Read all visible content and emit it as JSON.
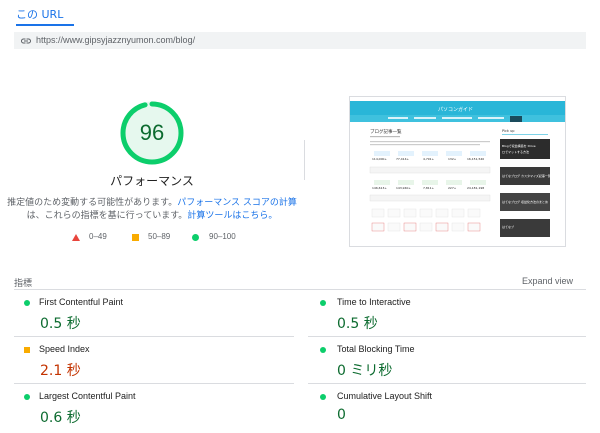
{
  "tab": {
    "label": "この URL"
  },
  "url": {
    "text": "https://www.gipsyjazznyumon.com/blog/"
  },
  "score": {
    "value": "96",
    "title": "パフォーマンス",
    "desc_part1": "推定値のため変動する可能性があります。",
    "desc_link1": "パフォーマンス スコアの計算",
    "desc_part2": "は、これらの指標を基に行っています。",
    "desc_link2": "計算ツールはこちら。",
    "fraction": 0.96,
    "color": "#0cce6b"
  },
  "legend": {
    "fail": "0–49",
    "average": "50–89",
    "pass": "90–100"
  },
  "thumbnail": {
    "site_title": "パソコンガイド",
    "page_heading": "ブログ記事一覧",
    "sidebar_heading": "Pick up",
    "side_items": [
      "Blogで収益構造を Drive",
      "ロでマットする方法",
      "はてなブログ カスタマイズ記事一覧",
      "はてなブログ 収益化方法のまとめ",
      "はてなブ"
    ],
    "stats_row1": [
      "114,000+",
      "77,414+",
      "4,791+",
      "132+",
      "16,151,540"
    ],
    "stats_row2": [
      "146,613+",
      "143,940+",
      "7,811+",
      "227+",
      "24,181,198"
    ]
  },
  "metrics": {
    "section_label": "指標",
    "expand_label": "Expand view",
    "fcp": {
      "name": "First Contentful Paint",
      "value": "0.5 秒",
      "status": "pass"
    },
    "tti": {
      "name": "Time to Interactive",
      "value": "0.5 秒",
      "status": "pass"
    },
    "si": {
      "name": "Speed Index",
      "value": "2.1 秒",
      "status": "average"
    },
    "tbt": {
      "name": "Total Blocking Time",
      "value": "0 ミリ秒",
      "status": "pass"
    },
    "lcp": {
      "name": "Largest Contentful Paint",
      "value": "0.6 秒",
      "status": "pass"
    },
    "cls": {
      "name": "Cumulative Layout Shift",
      "value": "0",
      "status": "pass"
    }
  },
  "colors": {
    "pass": "#0cce6b",
    "average": "#f9ab00",
    "fail": "#e8453c",
    "link": "#1a73e8"
  }
}
